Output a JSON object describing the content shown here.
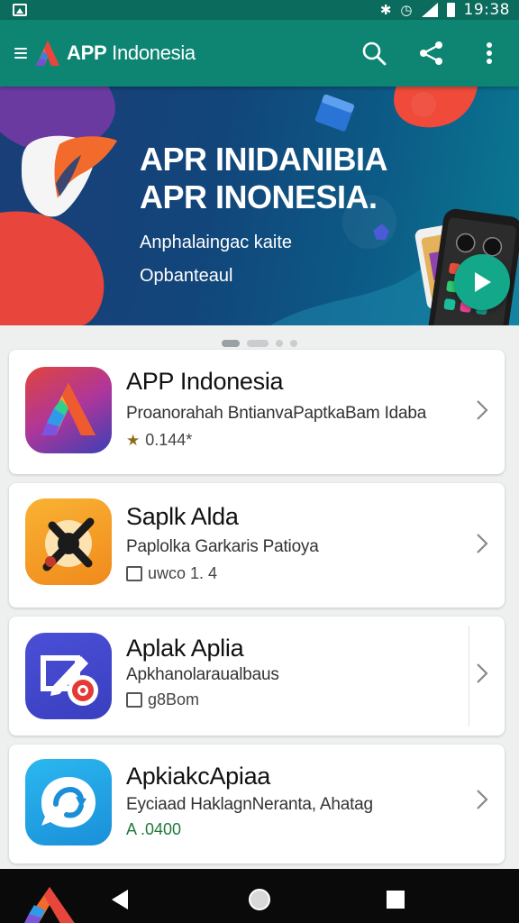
{
  "status_bar": {
    "time": "19:38",
    "icons": [
      "image-icon",
      "bluetooth-icon",
      "alarm-icon",
      "signal-icon",
      "battery-icon"
    ]
  },
  "app_bar": {
    "title_bold": "APP",
    "title_rest": " Indonesia",
    "actions": [
      "search-icon",
      "share-icon",
      "more-vert-icon"
    ]
  },
  "banner": {
    "title_line1": "APR INIDANIBIA",
    "title_line2": "APR INONESIA.",
    "subtitle_line1": "Anphalaingac kaite",
    "subtitle_line2": "Opbanteaul",
    "colors": {
      "accent": "#13a88a",
      "primary": "#0d8572"
    }
  },
  "pager": {
    "count": 4,
    "active": 0
  },
  "apps": [
    {
      "name": "APP Indonesia",
      "description": "Proanorahah BntianvaPaptkaBam Idaba",
      "meta": "0.144*",
      "meta_icon": "star-icon",
      "icon": "app-indonesia-logo-icon"
    },
    {
      "name": "Saplk Alda",
      "description": "Paplolka Garkaris Patioya",
      "meta": "uwco 1. 4",
      "meta_icon": "box-icon",
      "icon": "tools-icon"
    },
    {
      "name": "Aplak Aplia",
      "description": "Apkhanolaraualbaus",
      "meta": "g8Bom",
      "meta_icon": "box-icon",
      "icon": "edit-record-icon"
    },
    {
      "name": "ApkiakcApiaa",
      "description": "Eyciaad HaklagnNeranta, Ahatag",
      "meta": "A .0400",
      "meta_icon": "",
      "icon": "chat-refresh-icon"
    }
  ],
  "nav_bar": [
    "home-logo-icon",
    "back-icon",
    "home-icon",
    "recents-icon"
  ]
}
